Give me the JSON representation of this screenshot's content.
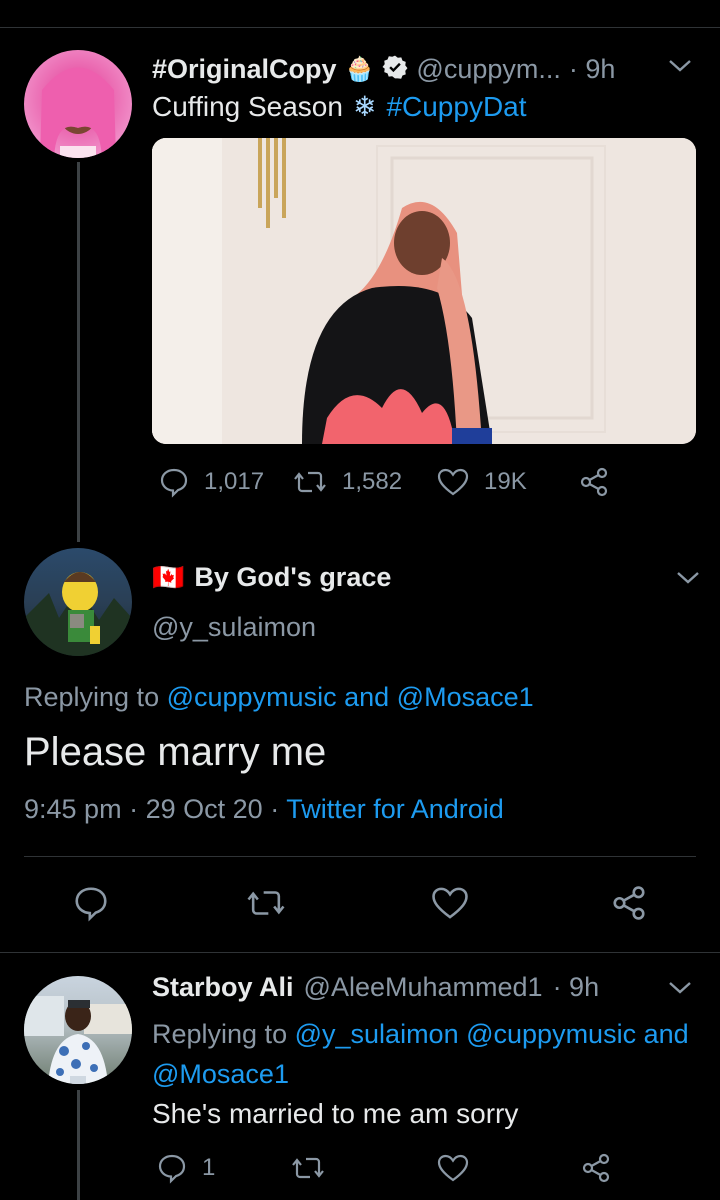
{
  "tweet1": {
    "name": "#OriginalCopy",
    "handle": "@cuppym...",
    "time": "· 9h",
    "text_plain": "Cuffing Season",
    "hashtag": "#CuppyDat",
    "emoji_cupcake": "🧁",
    "emoji_snowflake": "❄",
    "replies": "1,017",
    "retweets": "1,582",
    "likes": "19K"
  },
  "main": {
    "flag": "🇨🇦",
    "name": "By God's grace",
    "handle": "@y_sulaimon",
    "replying_prefix": "Replying to",
    "replying_user1": "@cuppymusic",
    "replying_and": "and",
    "replying_user2": "@Mosace1",
    "text": "Please marry me",
    "time": "9:45 pm",
    "date": "29 Oct 20",
    "sep": "·",
    "source": "Twitter for Android"
  },
  "reply": {
    "name": "Starboy Ali",
    "handle": "@AleeMuhammed1",
    "time": "· 9h",
    "replying_prefix": "Replying to",
    "replying_user1": "@y_sulaimon",
    "replying_user2": "@cuppymusic",
    "replying_and": "and",
    "replying_user3": "@Mosace1",
    "text": "She's married to me am sorry",
    "replies": "1"
  },
  "icons": {
    "reply": "speech-bubble-icon",
    "retweet": "retweet-icon",
    "like": "heart-icon",
    "share": "share-icon",
    "more": "chevron-down-icon",
    "verified": "verified-badge-icon"
  }
}
